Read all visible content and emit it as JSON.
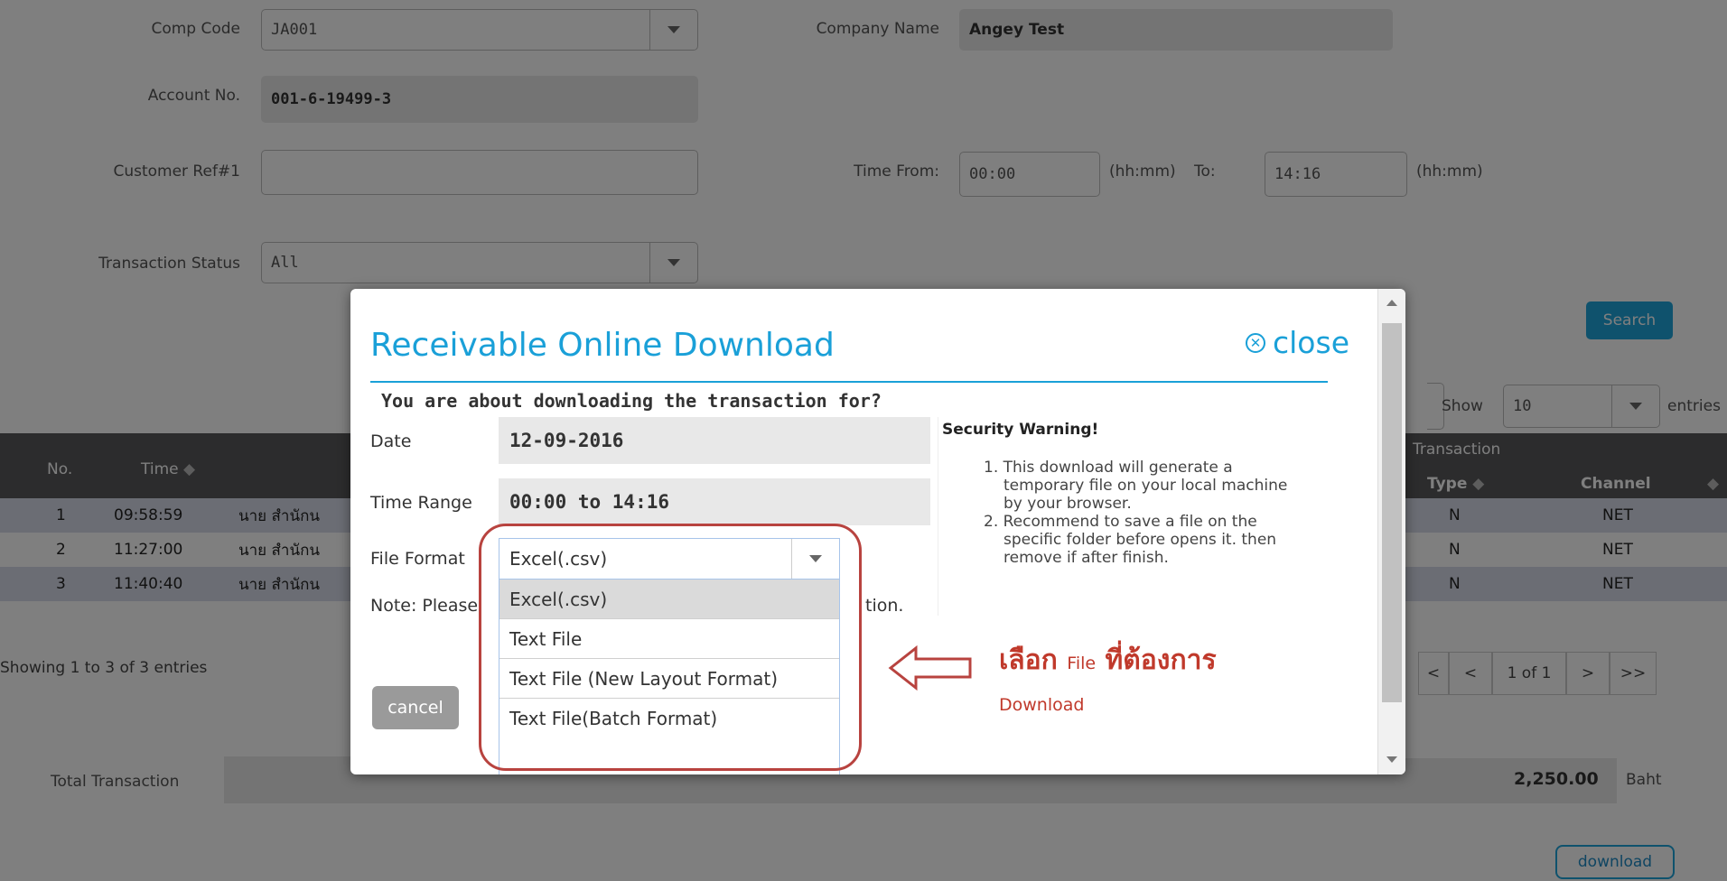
{
  "form": {
    "comp_code_label": "Comp Code",
    "comp_code_value": "JA001",
    "company_name_label": "Company Name",
    "company_name_value": "Angey Test",
    "account_no_label": "Account No.",
    "account_no_value": "001-6-19499-3",
    "customer_ref_label": "Customer Ref#1",
    "customer_ref_value": "",
    "time_from_label": "Time From:",
    "time_from_value": "00:00",
    "hhmm1": "(hh:mm)",
    "to_label": "To:",
    "time_to_value": "14:16",
    "hhmm2": "(hh:mm)",
    "transaction_status_label": "Transaction Status",
    "transaction_status_value": "All",
    "search_label": "Search"
  },
  "table": {
    "show_label": "Show",
    "entries_count": "10",
    "entries_label": "entries",
    "headers": {
      "no": "No.",
      "time": "Time",
      "transaction": "Transaction",
      "type": "Type",
      "channel": "Channel"
    },
    "rows": [
      {
        "no": "1",
        "time": "09:58:59",
        "name": "นาย สำนักน",
        "type": "N",
        "channel": "NET"
      },
      {
        "no": "2",
        "time": "11:27:00",
        "name": "นาย สำนักน",
        "type": "N",
        "channel": "NET"
      },
      {
        "no": "3",
        "time": "11:40:40",
        "name": "นาย สำนักน",
        "type": "N",
        "channel": "NET"
      }
    ],
    "showing_text": "Showing 1 to 3 of 3 entries",
    "pagination": {
      "first": "<",
      "prev": "<",
      "page": "1 of 1",
      "next": ">",
      "last": ">>"
    }
  },
  "totals": {
    "total_transaction_label": "Total Transaction",
    "total_amount": "2,250.00",
    "currency": "Baht",
    "download_label": "download"
  },
  "modal": {
    "title": "Receivable Online Download",
    "close_label": "close",
    "question": "You are about downloading the transaction for?",
    "date_label": "Date",
    "date_value": "12-09-2016",
    "time_range_label": "Time Range",
    "time_range_value": "00:00 to 14:16",
    "file_format_label": "File Format",
    "file_format_value": "Excel(.csv)",
    "note_prefix": "Note: Please",
    "note_suffix": "tion.",
    "cancel_label": "cancel",
    "options": [
      "Excel(.csv)",
      "Text File",
      "Text File (New Layout Format)",
      "Text File(Batch Format)"
    ],
    "security_title": "Security Warning!",
    "warnings": [
      "1. This download will generate a",
      "temporary file on your local machine",
      "by your browser.",
      "2. Recommend to save a file on the",
      "specific folder before opens it. then",
      "remove if after finish."
    ]
  },
  "annotation": {
    "line1_a": "เลือก",
    "line1_b": "File",
    "line1_c": "ที่ต้องการ",
    "line2": "Download"
  }
}
